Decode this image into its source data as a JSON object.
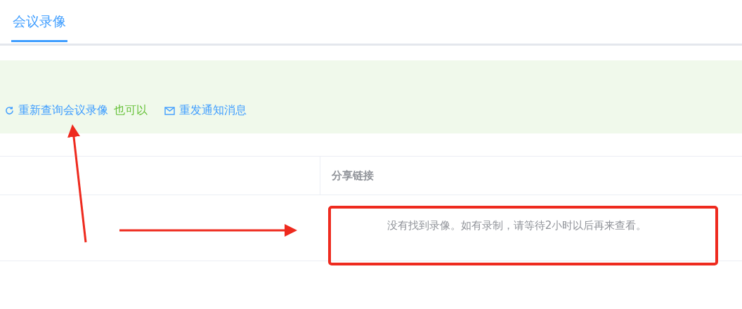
{
  "tabs": [
    {
      "label": "会议录像",
      "selected": true
    }
  ],
  "actions": [
    {
      "kind": "refresh",
      "label": "重新查询会议录像"
    },
    {
      "kind": "note",
      "label": "也可以"
    },
    {
      "kind": "mail",
      "label": "重发通知消息"
    }
  ],
  "table": {
    "columns": [
      "",
      "分享链接"
    ],
    "empty_message": "没有找到录像。如有录制，请等待2小时以后再来查看。"
  }
}
